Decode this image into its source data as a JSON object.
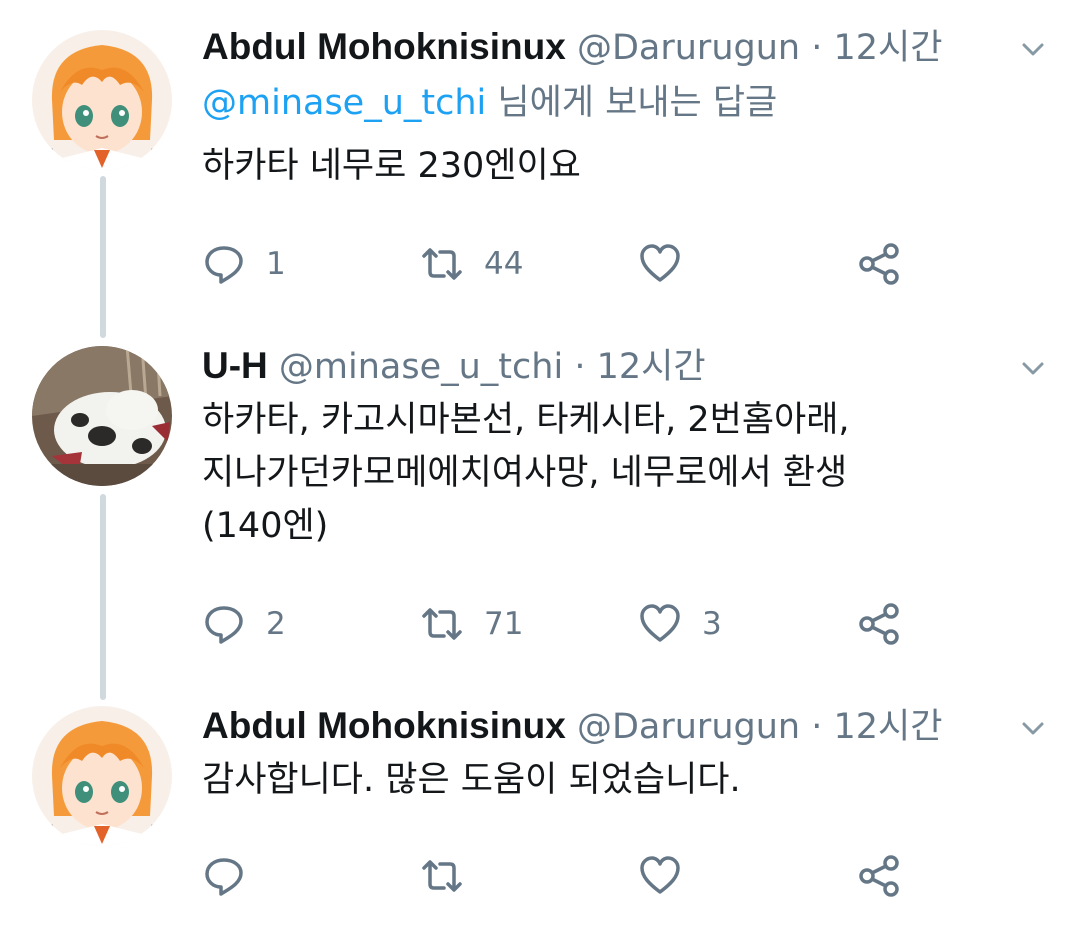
{
  "tweets": [
    {
      "name": "Abdul Mohoknisinux",
      "handle": "@Darurugun",
      "separator": "·",
      "time": "12시간",
      "reply_mention": "@minase_u_tchi",
      "reply_suffix": " 님에게 보내는 답글",
      "text": "하카타 네무로 230엔이요",
      "reply_count": "1",
      "retweet_count": "44",
      "like_count": "",
      "avatar": "anime-girl-avatar"
    },
    {
      "name": "U-H",
      "handle": "@minase_u_tchi",
      "separator": "·",
      "time": "12시간",
      "text": "하카타, 카고시마본선, 타케시타, 2번홈아래,\n지나가던카모메에치여사망, 네무로에서 환생\n(140엔)",
      "reply_count": "2",
      "retweet_count": "71",
      "like_count": "3",
      "avatar": "cat-photo-avatar"
    },
    {
      "name": "Abdul Mohoknisinux",
      "handle": "@Darurugun",
      "separator": "·",
      "time": "12시간",
      "text": "감사합니다. 많은 도움이 되었습니다.",
      "reply_count": "",
      "retweet_count": "",
      "like_count": "",
      "avatar": "anime-girl-avatar"
    }
  ],
  "colors": {
    "name": "#14171a",
    "secondary": "#657786",
    "mention": "#1da1f2",
    "thread_line": "#cfd9de"
  },
  "icons": [
    "reply-icon",
    "retweet-icon",
    "like-icon",
    "share-icon",
    "chevron-down-icon"
  ]
}
